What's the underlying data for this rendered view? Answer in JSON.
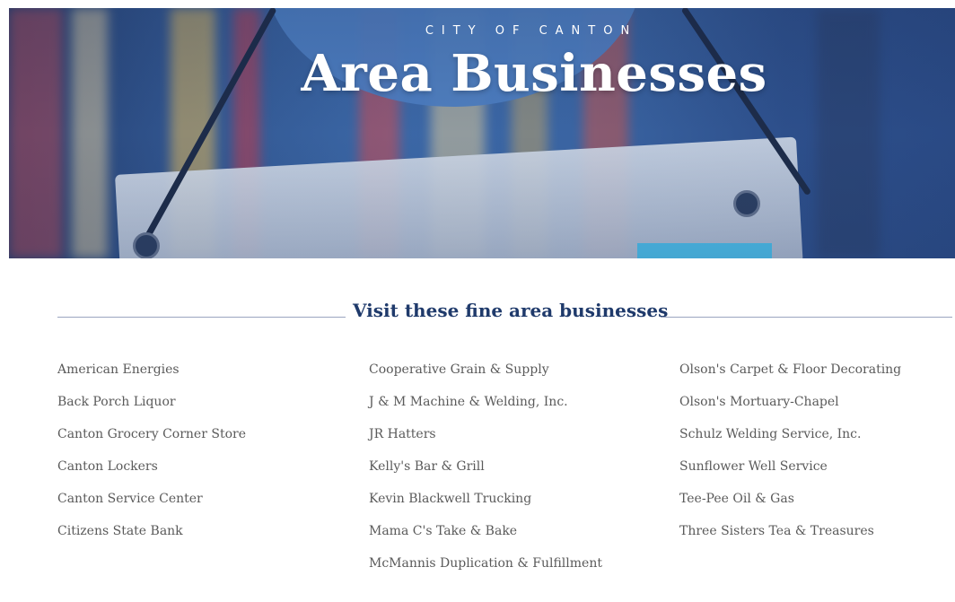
{
  "hero": {
    "kicker": "CITY OF CANTON",
    "title": "Area Businesses"
  },
  "section": {
    "heading": "Visit these fine area businesses"
  },
  "businesses": {
    "column1": [
      "American Energies",
      "Back Porch Liquor",
      "Canton Grocery Corner Store",
      "Canton Lockers",
      "Canton Service Center",
      "Citizens State Bank"
    ],
    "column2": [
      "Cooperative Grain & Supply",
      "J & M Machine & Welding, Inc.",
      "JR Hatters",
      "Kelly's Bar & Grill",
      "Kevin Blackwell Trucking",
      "Mama C's Take & Bake",
      "McMannis Duplication & Fulfillment"
    ],
    "column3": [
      "Olson's Carpet & Floor Decorating",
      "Olson's Mortuary-Chapel",
      "Schulz Welding Service, Inc.",
      "Sunflower Well Service",
      "Tee-Pee Oil & Gas",
      "Three Sisters Tea & Treasures"
    ]
  },
  "colors": {
    "heading": "#1f3a6b",
    "list_text": "#5a5a5a",
    "hero_blue": "#3b67a6",
    "rule": "#9aa5bf"
  }
}
